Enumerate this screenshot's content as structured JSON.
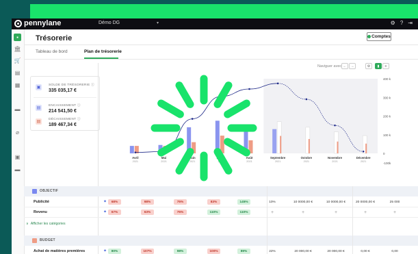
{
  "app": {
    "logo": "pennylane",
    "company": "Démo DG",
    "page_title": "Trésorerie",
    "comptes_label": "Comptes"
  },
  "topbar": {
    "icons": [
      "gear-icon",
      "help-icon",
      "logout-icon"
    ]
  },
  "sidebar": {
    "icons": [
      "dashboard-icon",
      "bank-icon",
      "cart-icon",
      "invoice-icon",
      "grid-icon",
      "folder-icon",
      "attachment-icon",
      "document-icon",
      "folder-icon"
    ]
  },
  "tabs": [
    {
      "label": "Tableau de bord",
      "active": false
    },
    {
      "label": "Plan de trésorerie",
      "active": true
    }
  ],
  "toolbar": {
    "navigate_label": "Naviguer avec",
    "prev": "←",
    "next": "→"
  },
  "kpis": {
    "solde": {
      "label": "SOLDE DE TRÉSORERIE ⓘ",
      "value": "335 035,17 €"
    },
    "encaissement": {
      "label": "ENCAISSEMENT ⓘ",
      "value": "214 541,50 €"
    },
    "decaissement": {
      "label": "DÉCAISSEMENT ⓘ",
      "value": "189 467,34 €"
    }
  },
  "chart_data": {
    "type": "bar",
    "categories": [
      {
        "month": "Avril",
        "year": "2021"
      },
      {
        "month": "Mai",
        "year": "2021"
      },
      {
        "month": "Juin",
        "year": "2021"
      },
      {
        "month": "Juillet",
        "year": "2021"
      },
      {
        "month": "Août",
        "year": "2021"
      },
      {
        "month": "Septembre",
        "year": "2021"
      },
      {
        "month": "Octobre",
        "year": "2021"
      },
      {
        "month": "Novembre",
        "year": "2021"
      },
      {
        "month": "Décembre",
        "year": "2021"
      }
    ],
    "series": [
      {
        "values": [
          40,
          45,
          140,
          175,
          135,
          130,
          0,
          0,
          0
        ],
        "color": "#8a94ef"
      },
      {
        "values": [
          40,
          40,
          60,
          95,
          70,
          170,
          140,
          115,
          95
        ],
        "color": "#ef9c85"
      }
    ],
    "line": [
      5,
      10,
      185,
      305,
      345,
      375,
      290,
      150,
      10
    ],
    "y_ticks": [
      "400 k",
      "300 k",
      "200 k",
      "100 k",
      "0",
      "-100k"
    ],
    "ylim": [
      -100,
      400
    ]
  },
  "objectif": {
    "label": "OBJECTIF",
    "rows": [
      {
        "label": "Publicité",
        "cells": [
          "68%",
          "98%",
          "75%",
          "83%",
          "145%",
          "10%",
          "10 0000,00 €",
          "10 0000,00 €",
          "20 0000,00 €",
          "25 000"
        ]
      },
      {
        "label": "Revenu",
        "cells": [
          "67%",
          "63%",
          "75%",
          "110%",
          "110%",
          "+",
          "+",
          "+",
          "+",
          "+"
        ]
      }
    ],
    "show_categories": "Afficher les catégories"
  },
  "budget": {
    "label": "BUDGET",
    "rows": [
      {
        "label": "Achat de matières premières",
        "cells": [
          "80%",
          "107%",
          "98%",
          "100%",
          "89%",
          "22%",
          "20 000,00 €",
          "20 000,00 €",
          "0,00 €",
          "0,00"
        ]
      }
    ]
  }
}
